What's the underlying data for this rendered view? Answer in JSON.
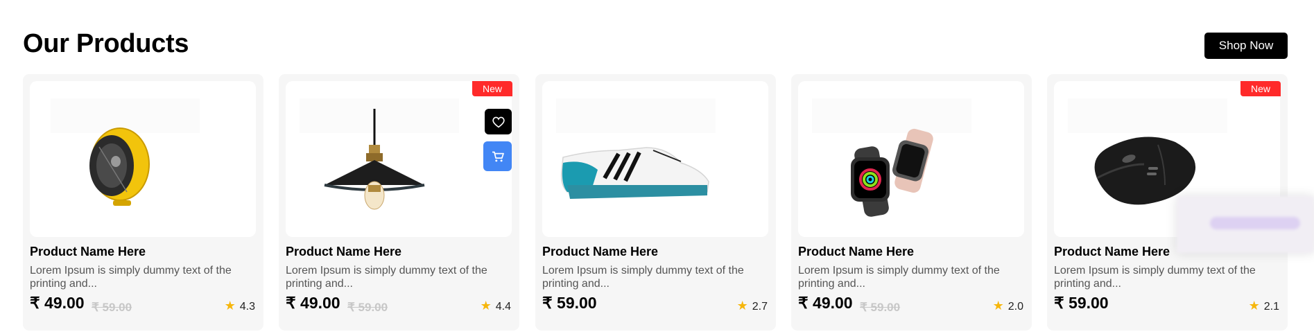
{
  "section": {
    "title": "Our Products",
    "cta_label": "Shop Now"
  },
  "colors": {
    "badge": "#ff2a2a",
    "cart_button": "#4286f5",
    "star": "#f6b60c",
    "card_bg": "#f6f6f6"
  },
  "products": [
    {
      "image_icon": "speaker-icon",
      "badge": "",
      "name": "Product Name Here",
      "description": "Lorem Ipsum is simply dummy text of the printing and...",
      "price": "₹ 49.00",
      "old_price": "₹ 59.00",
      "rating": "4.3"
    },
    {
      "image_icon": "pendant-lamp-icon",
      "badge": "New",
      "name": "Product Name Here",
      "description": "Lorem Ipsum is simply dummy text of the printing and...",
      "price": "₹ 49.00",
      "old_price": "₹ 59.00",
      "rating": "4.4"
    },
    {
      "image_icon": "sneaker-icon",
      "badge": "",
      "name": "Product Name Here",
      "description": "Lorem Ipsum is simply dummy text of the printing and...",
      "price": "₹ 59.00",
      "old_price": "",
      "rating": "2.7"
    },
    {
      "image_icon": "smartwatch-icon",
      "badge": "",
      "name": "Product Name Here",
      "description": "Lorem Ipsum is simply dummy text of the printing and...",
      "price": "₹ 49.00",
      "old_price": "₹ 59.00",
      "rating": "2.0"
    },
    {
      "image_icon": "mouse-icon",
      "badge": "New",
      "name": "Product Name Here",
      "description": "Lorem Ipsum is simply dummy text of the printing and...",
      "price": "₹ 59.00",
      "old_price": "",
      "rating": "2.1"
    }
  ],
  "hover_actions": {
    "wishlist_icon": "heart-icon",
    "cart_icon": "cart-icon"
  }
}
